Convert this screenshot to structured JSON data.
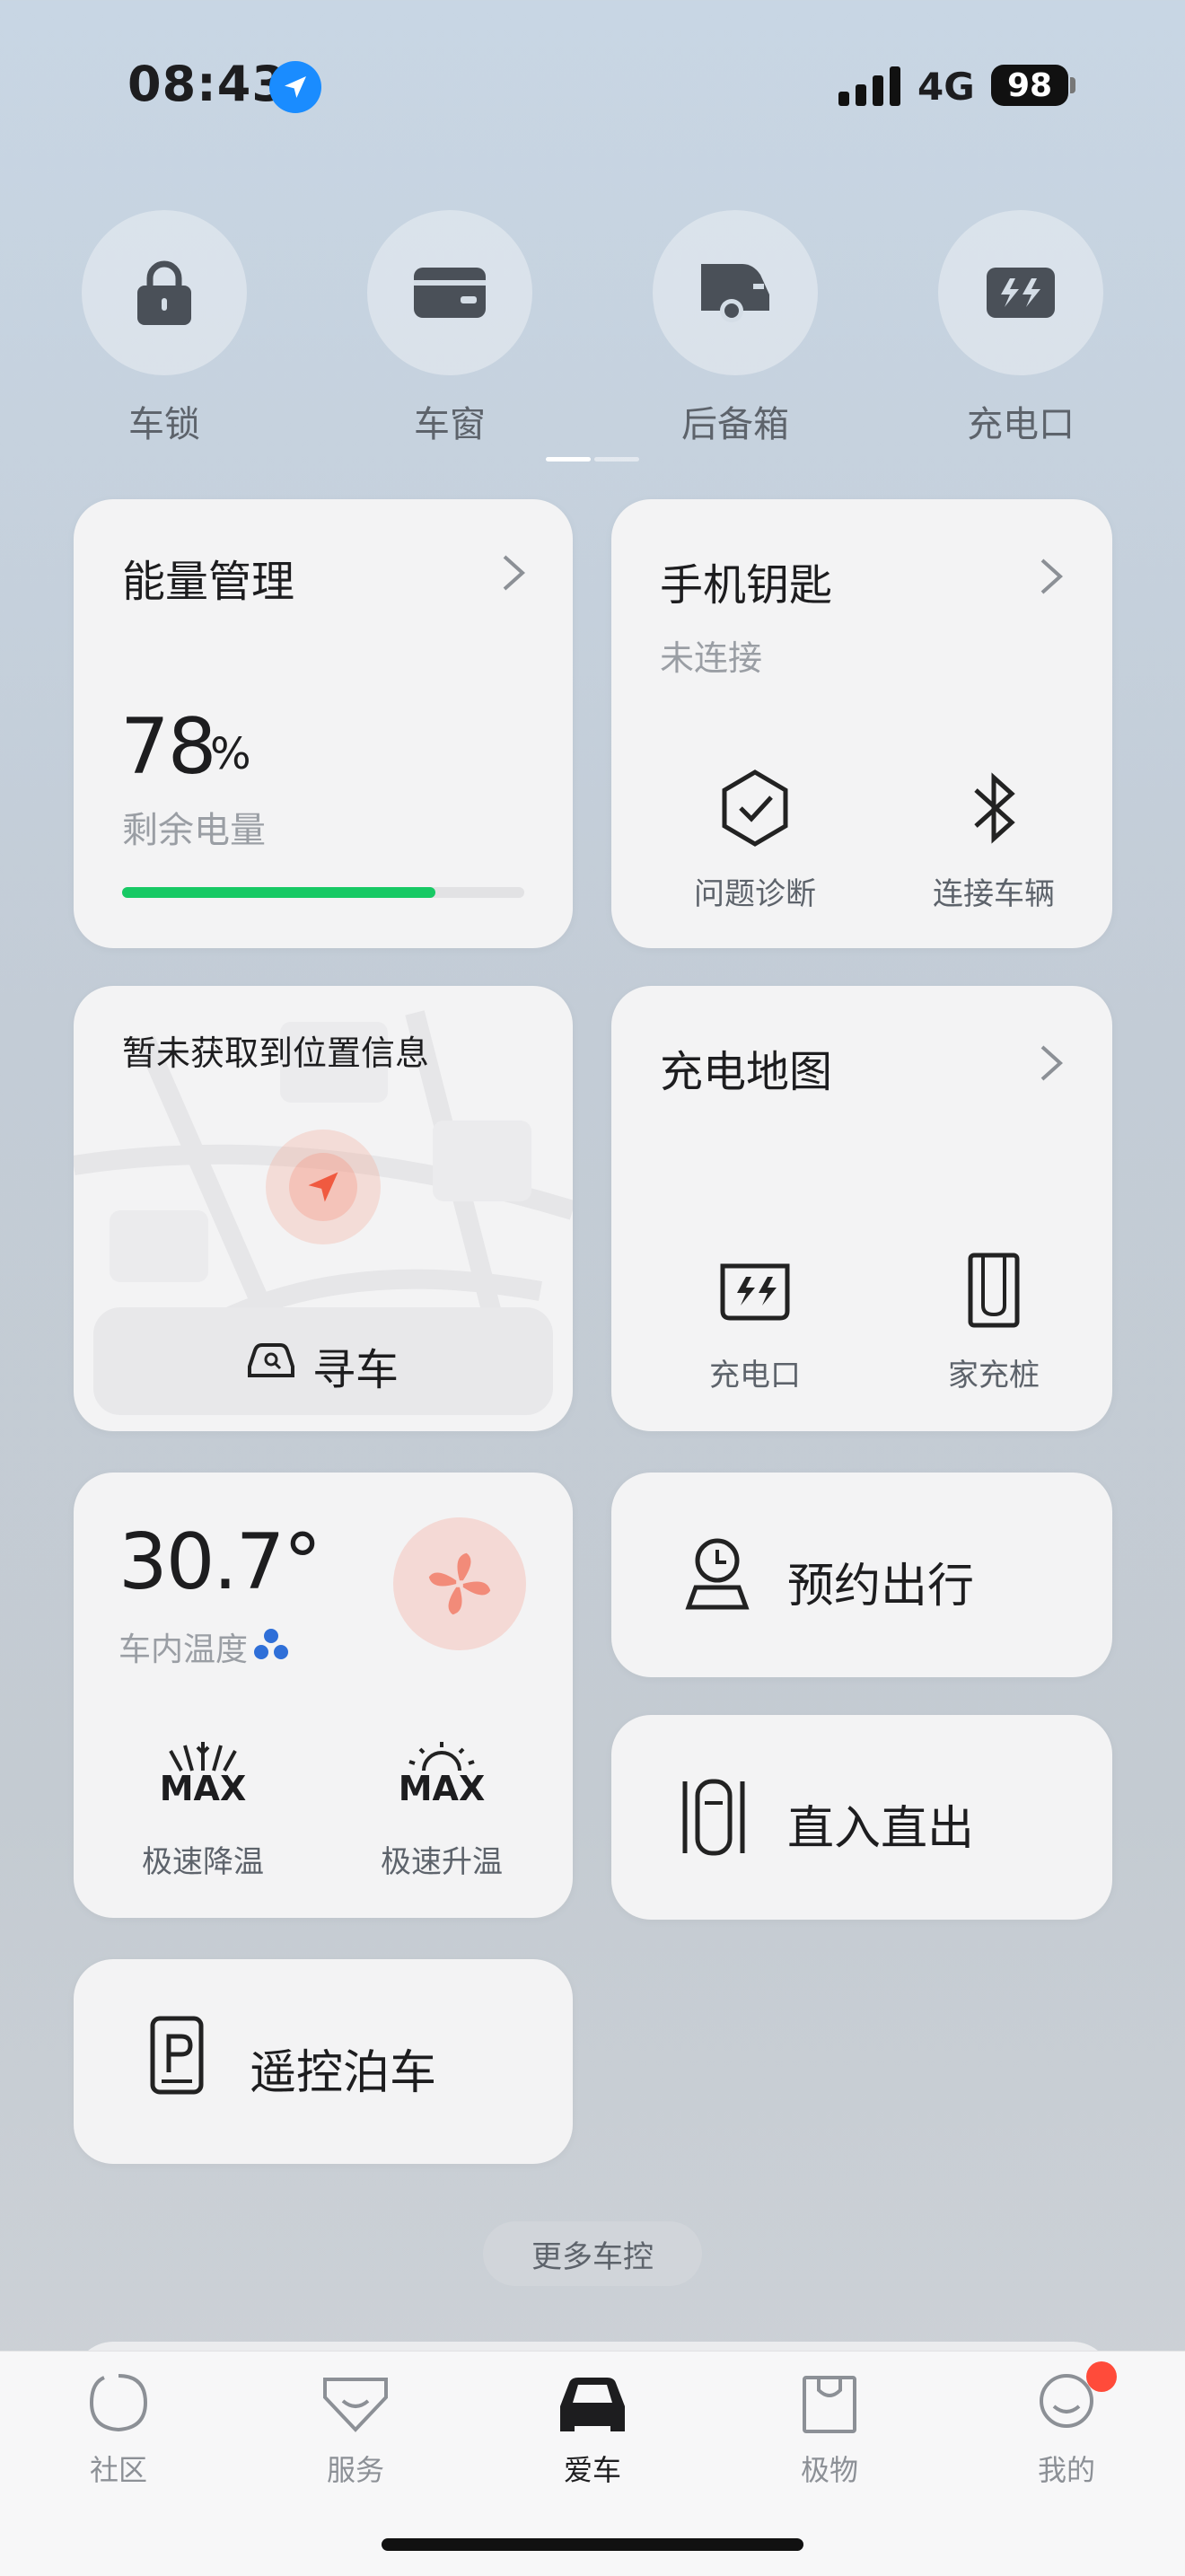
{
  "status": {
    "time": "08:43",
    "network": "4G",
    "battery": "98"
  },
  "quick_controls": [
    {
      "label": "车锁",
      "icon": "lock-icon"
    },
    {
      "label": "车窗",
      "icon": "window-icon"
    },
    {
      "label": "后备箱",
      "icon": "trunk-icon"
    },
    {
      "label": "充电口",
      "icon": "charge-port-icon"
    }
  ],
  "energy": {
    "title": "能量管理",
    "percent": "78",
    "unit": "%",
    "caption": "剩余电量",
    "level": 0.78,
    "bar_color": "#17c964"
  },
  "phone_key": {
    "title": "手机钥匙",
    "status": "未连接",
    "actions": [
      "问题诊断",
      "连接车辆"
    ]
  },
  "locate": {
    "message": "暂未获取到位置信息",
    "button": "寻车"
  },
  "charge_map": {
    "title": "充电地图",
    "actions": [
      "充电口",
      "家充桩"
    ]
  },
  "climate": {
    "temp": "30.7°",
    "caption": "车内温度",
    "max_label": "MAX",
    "actions": [
      "极速降温",
      "极速升温"
    ]
  },
  "schedule": {
    "label": "预约出行"
  },
  "straight": {
    "label": "直入直出"
  },
  "parking": {
    "label": "遥控泊车"
  },
  "more": {
    "label": "更多车控"
  },
  "tabs": [
    {
      "label": "社区",
      "active": false
    },
    {
      "label": "服务",
      "active": false
    },
    {
      "label": "爱车",
      "active": true
    },
    {
      "label": "极物",
      "active": false
    },
    {
      "label": "我的",
      "active": false
    }
  ],
  "colors": {
    "accent_red": "#ff4b3a",
    "fan": "#f28b79",
    "text_muted": "#9a9ea4"
  }
}
